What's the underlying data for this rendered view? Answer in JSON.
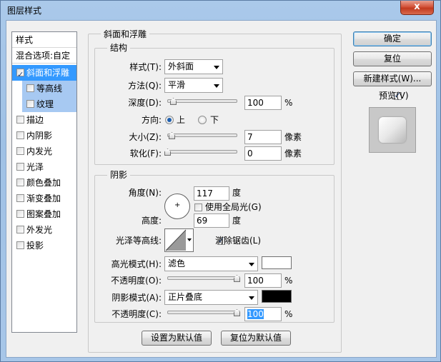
{
  "window": {
    "title": "图层样式",
    "close_label": "x"
  },
  "left_panel": {
    "header": "样式",
    "blend_options": "混合选项:自定",
    "items": [
      {
        "label": "斜面和浮雕",
        "checked": true,
        "selected": true
      },
      {
        "label": "等高线",
        "checked": false,
        "sub": true
      },
      {
        "label": "纹理",
        "checked": false,
        "sub": true
      },
      {
        "label": "描边",
        "checked": false
      },
      {
        "label": "内阴影",
        "checked": false
      },
      {
        "label": "内发光",
        "checked": false
      },
      {
        "label": "光泽",
        "checked": false
      },
      {
        "label": "颜色叠加",
        "checked": false
      },
      {
        "label": "渐变叠加",
        "checked": false
      },
      {
        "label": "图案叠加",
        "checked": false
      },
      {
        "label": "外发光",
        "checked": false
      },
      {
        "label": "投影",
        "checked": false
      }
    ]
  },
  "bevel": {
    "section_title": "斜面和浮雕",
    "structure": {
      "title": "结构",
      "style_label": "样式(T):",
      "style_value": "外斜面",
      "method_label": "方法(Q):",
      "method_value": "平滑",
      "depth_label": "深度(D):",
      "depth_value": "100",
      "depth_unit": "%",
      "direction_label": "方向:",
      "dir_up": "上",
      "dir_down": "下",
      "dir_selected": "上",
      "size_label": "大小(Z):",
      "size_value": "7",
      "size_unit": "像素",
      "soften_label": "软化(F):",
      "soften_value": "0",
      "soften_unit": "像素"
    },
    "shading": {
      "title": "阴影",
      "angle_label": "角度(N):",
      "angle_value": "117",
      "angle_unit": "度",
      "global_light_label": "使用全局光(G)",
      "global_light_checked": false,
      "altitude_label": "高度:",
      "altitude_value": "69",
      "altitude_unit": "度",
      "gloss_label": "光泽等高线:",
      "antialias_label": "消除锯齿(L)",
      "antialias_checked": true,
      "highlight_mode_label": "高光模式(H):",
      "highlight_mode_value": "滤色",
      "highlight_color": "#ffffff",
      "highlight_opacity_label": "不透明度(O):",
      "highlight_opacity_value": "100",
      "highlight_opacity_unit": "%",
      "shadow_mode_label": "阴影模式(A):",
      "shadow_mode_value": "正片叠底",
      "shadow_color": "#000000",
      "shadow_opacity_label": "不透明度(C):",
      "shadow_opacity_value": "100",
      "shadow_opacity_unit": "%"
    },
    "make_default": "设置为默认值",
    "reset_default": "复位为默认值"
  },
  "right": {
    "ok": "确定",
    "reset": "复位",
    "new_style": "新建样式(W)...",
    "preview_label": "预览(V)",
    "preview_checked": true
  }
}
